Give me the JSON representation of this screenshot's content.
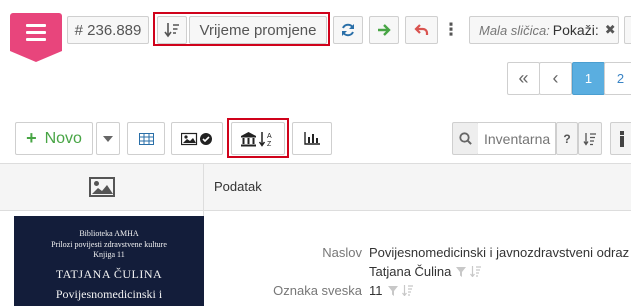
{
  "toolbar": {
    "record_id": "# 236.889",
    "sort_field": "Vrijeme promjene",
    "thumbnail_label": "Mala sličica:",
    "thumbnail_value": "Pokaži:"
  },
  "pagination": {
    "first": "«",
    "prev": "‹",
    "pages": [
      "1",
      "2"
    ],
    "current": "1"
  },
  "grid_toolbar": {
    "new_label": "Novo",
    "search_placeholder": "Inventarna",
    "search_help": "?"
  },
  "table": {
    "data_column_header": "Podatak"
  },
  "record": {
    "cover": {
      "line1": "Biblioteka AMHA",
      "line2": "Prilozi povijesti zdravstvene kulture",
      "line3": "Knjiga 11",
      "author": "TATJANA ČULINA",
      "title": "Povijesnomedicinski i"
    },
    "fields": {
      "title_label": "Naslov",
      "title_value": "Povijesnomedicinski i javnozdravstveni odraz",
      "author_value": "Tatjana Čulina",
      "call_number_label": "Oznaka sveska",
      "call_number_value": "11"
    }
  },
  "colors": {
    "menu_accent": "#e8457c",
    "highlight_border": "#d0021b",
    "active_page": "#5aaee0",
    "new_button_text": "#48a545",
    "cover_background": "#131d3a"
  },
  "icons": {
    "menu": "hamburger-icon",
    "sort_order": "sort-descending-icon",
    "refresh": "refresh-icon",
    "forward": "arrow-right-icon",
    "undo": "undo-icon",
    "more": "vertical-dots-icon",
    "close": "close-icon",
    "table_view": "table-icon",
    "image_view": "image-check-icon",
    "institution_sort": "institution-sort-az-icon",
    "chart": "bar-chart-icon",
    "search": "search-icon",
    "image_column": "image-icon",
    "filter": "filter-icon",
    "sort": "sort-icon"
  }
}
